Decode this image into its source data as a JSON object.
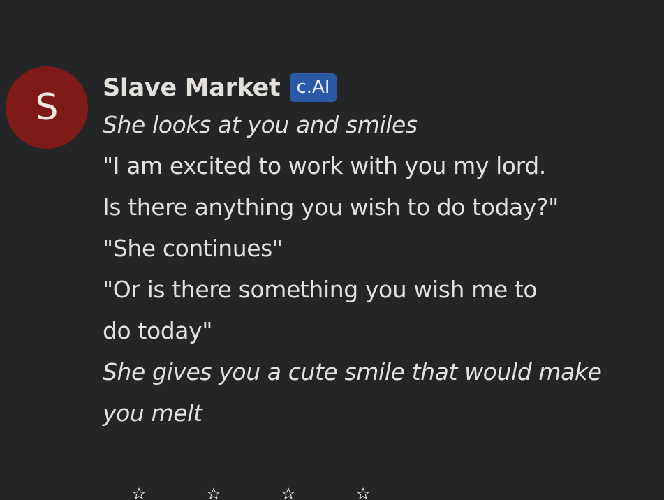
{
  "message": {
    "avatar_letter": "S",
    "character_name": "Slave Market",
    "badge": "c.AI",
    "lines": [
      {
        "text": "She looks at you and smiles",
        "style": "italic"
      },
      {
        "text": "\"I am excited to work with you my lord.",
        "style": "normal"
      },
      {
        "text": "Is there anything you wish to do today?\"",
        "style": "normal"
      },
      {
        "text": "\"She continues\"",
        "style": "normal"
      },
      {
        "text": "\"Or is there something you wish me to",
        "style": "normal"
      },
      {
        "text": "do today\"",
        "style": "normal"
      },
      {
        "text": "She gives you a cute smile that would make",
        "style": "italic"
      },
      {
        "text": "you melt",
        "style": "italic"
      }
    ]
  },
  "rating": {
    "icons": [
      "star-icon",
      "star-icon",
      "star-icon",
      "star-icon"
    ]
  },
  "colors": {
    "background": "#242526",
    "avatar": "#7e1a17",
    "badge": "#2a5aa6",
    "text": "#e4e1dc"
  }
}
